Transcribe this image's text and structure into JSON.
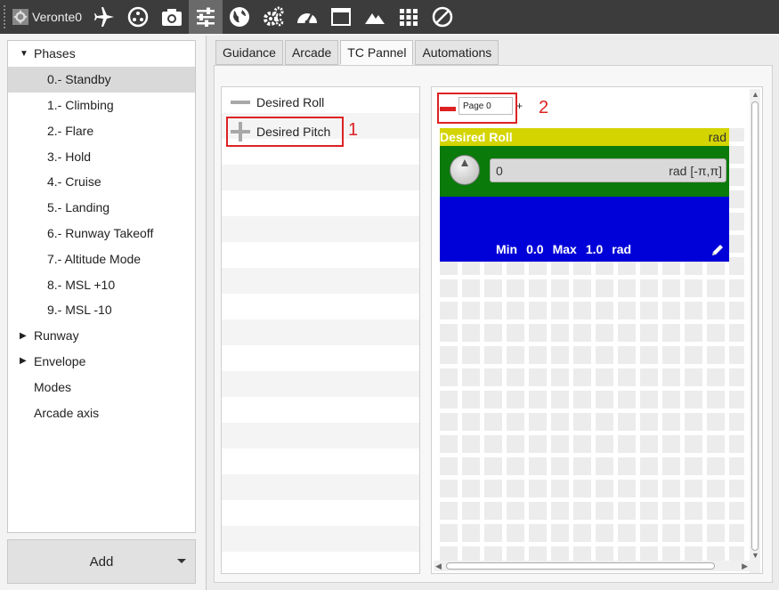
{
  "app": {
    "title": "Veronte0",
    "toolbar_icons": [
      "plane-icon",
      "target-icon",
      "camera-icon",
      "sliders-icon",
      "globe-icon",
      "gears-icon",
      "gauge-icon",
      "window-icon",
      "mountain-icon",
      "grid-icon",
      "disabled-icon"
    ],
    "active_icon": "sliders-icon"
  },
  "tree": {
    "phases_label": "Phases",
    "phases": [
      "0.- Standby",
      "1.- Climbing",
      "2.- Flare",
      "3.- Hold",
      "4.- Cruise",
      "5.- Landing",
      "6.- Runway Takeoff",
      "7.- Altitude Mode",
      "8.- MSL +10",
      "9.- MSL -10"
    ],
    "selected_phase": "0.- Standby",
    "runway_label": "Runway",
    "envelope_label": "Envelope",
    "modes_label": "Modes",
    "arcade_axis_label": "Arcade axis"
  },
  "add_button": {
    "label": "Add"
  },
  "tabs": [
    {
      "label": "Guidance"
    },
    {
      "label": "Arcade"
    },
    {
      "label": "TC Pannel"
    },
    {
      "label": "Automations"
    }
  ],
  "active_tab": "TC Pannel",
  "list": {
    "items": [
      {
        "label": "Desired Roll",
        "icon": "minus-icon"
      },
      {
        "label": "Desired Pitch",
        "icon": "plus-icon"
      }
    ]
  },
  "annotations": {
    "one": "1",
    "two": "2"
  },
  "page": {
    "field_value": "Page 0",
    "add_symbol": "+"
  },
  "widget": {
    "title": "Desired Roll",
    "unit": "rad",
    "value": "0",
    "range_label": "rad [-π,π]",
    "min_label": "Min",
    "min_value": "0.0",
    "max_label": "Max",
    "max_value": "1.0",
    "foot_unit": "rad",
    "colors": {
      "header": "#d4d400",
      "body": "#0a7a0a",
      "footer": "#0000d8"
    }
  },
  "colors": {
    "toolbar": "#3c3c3c",
    "annotation": "#dd2222"
  }
}
